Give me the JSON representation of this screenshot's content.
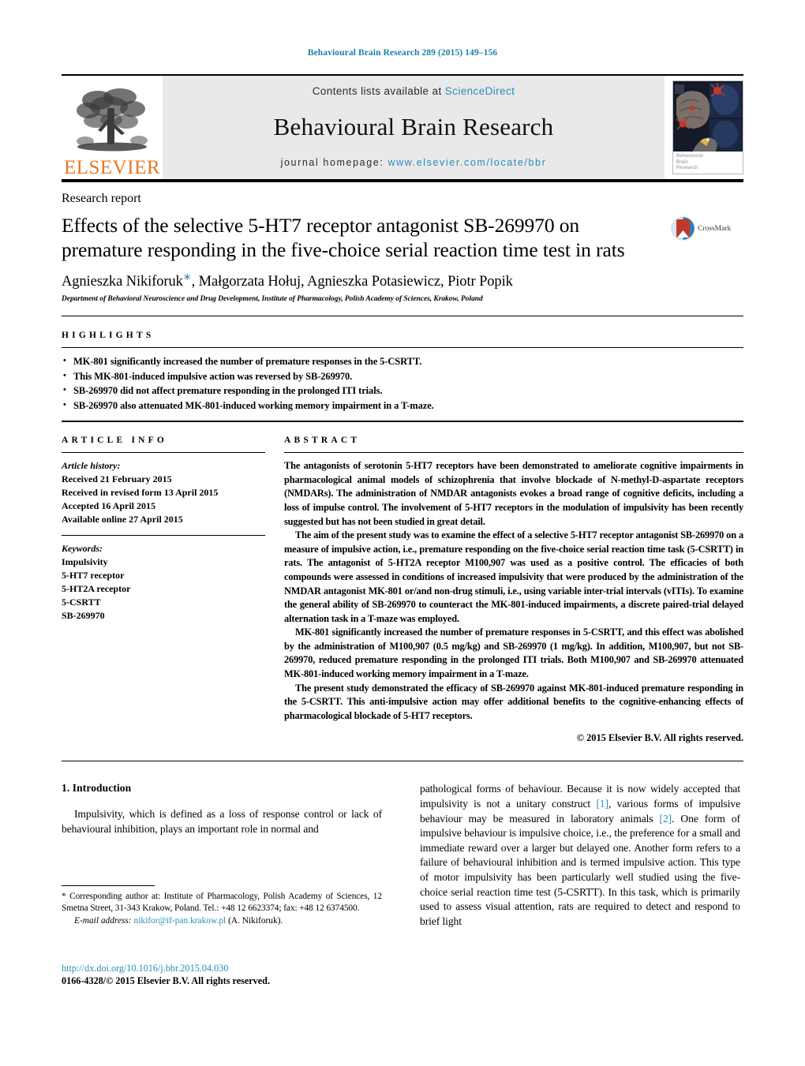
{
  "running_head": "Behavioural Brain Research 289 (2015) 149–156",
  "masthead": {
    "elsevier_wordmark": "ELSEVIER",
    "contents_prefix": "Contents lists available at ",
    "contents_link": "ScienceDirect",
    "journal_title": "Behavioural Brain Research",
    "homepage_prefix": "journal homepage: ",
    "homepage_link": "www.elsevier.com/locate/bbr",
    "cover_caption_line1": "Behavioural",
    "cover_caption_line2": "Brain",
    "cover_caption_line3": "Research"
  },
  "article": {
    "kicker": "Research report",
    "title": "Effects of the selective 5-HT7 receptor antagonist SB-269970 on premature responding in the five-choice serial reaction time test in rats",
    "crossmark_label": "CrossMark",
    "authors": "Agnieszka Nikiforuk",
    "authors_rest": ", Małgorzata Hołuj, Agnieszka Potasiewicz, Piotr Popik",
    "corresponding_mark": "∗",
    "affiliation": "Department of Behavioral Neuroscience and Drug Development, Institute of Pharmacology, Polish Academy of Sciences, Krakow, Poland"
  },
  "highlights": {
    "heading": "HIGHLIGHTS",
    "items": [
      "MK-801 significantly increased the number of premature responses in the 5-CSRTT.",
      "This MK-801-induced impulsive action was reversed by SB-269970.",
      "SB-269970 did not affect premature responding in the prolonged ITI trials.",
      "SB-269970 also attenuated MK-801-induced working memory impairment in a T-maze."
    ]
  },
  "article_info": {
    "heading": "ARTICLE INFO",
    "history_label": "Article history:",
    "history": [
      "Received 21 February 2015",
      "Received in revised form 13 April 2015",
      "Accepted 16 April 2015",
      "Available online 27 April 2015"
    ],
    "keywords_label": "Keywords:",
    "keywords": [
      "Impulsivity",
      "5-HT7 receptor",
      "5-HT2A receptor",
      "5-CSRTT",
      "SB-269970"
    ]
  },
  "abstract": {
    "heading": "ABSTRACT",
    "paragraphs": [
      "The antagonists of serotonin 5-HT7 receptors have been demonstrated to ameliorate cognitive impairments in pharmacological animal models of schizophrenia that involve blockade of N-methyl-D-aspartate receptors (NMDARs). The administration of NMDAR antagonists evokes a broad range of cognitive deficits, including a loss of impulse control. The involvement of 5-HT7 receptors in the modulation of impulsivity has been recently suggested but has not been studied in great detail.",
      "The aim of the present study was to examine the effect of a selective 5-HT7 receptor antagonist SB-269970 on a measure of impulsive action, i.e., premature responding on the five-choice serial reaction time task (5-CSRTT) in rats. The antagonist of 5-HT2A receptor M100,907 was used as a positive control. The efficacies of both compounds were assessed in conditions of increased impulsivity that were produced by the administration of the NMDAR antagonist MK-801 or/and non-drug stimuli, i.e., using variable inter-trial intervals (vITIs). To examine the general ability of SB-269970 to counteract the MK-801-induced impairments, a discrete paired-trial delayed alternation task in a T-maze was employed.",
      "MK-801 significantly increased the number of premature responses in 5-CSRTT, and this effect was abolished by the administration of M100,907 (0.5 mg/kg) and SB-269970 (1 mg/kg). In addition, M100,907, but not SB-269970, reduced premature responding in the prolonged ITI trials. Both M100,907 and SB-269970 attenuated MK-801-induced working memory impairment in a T-maze.",
      "The present study demonstrated the efficacy of SB-269970 against MK-801-induced premature responding in the 5-CSRTT. This anti-impulsive action may offer additional benefits to the cognitive-enhancing effects of pharmacological blockade of 5-HT7 receptors."
    ],
    "copyright": "© 2015 Elsevier B.V. All rights reserved."
  },
  "body": {
    "section_number_title": "1.  Introduction",
    "left_paragraph": "Impulsivity, which is defined as a loss of response control or lack of behavioural inhibition, plays an important role in normal and",
    "right_paragraph_part1": "pathological forms of behaviour. Because it is now widely accepted that impulsivity is not a unitary construct ",
    "ref1": "[1]",
    "right_paragraph_part2": ", various forms of impulsive behaviour may be measured in laboratory animals ",
    "ref2": "[2]",
    "right_paragraph_part3": ". One form of impulsive behaviour is impulsive choice, i.e., the preference for a small and immediate reward over a larger but delayed one. Another form refers to a failure of behavioural inhibition and is termed impulsive action. This type of motor impulsivity has been particularly well studied using the five-choice serial reaction time test (5-CSRTT). In this task, which is primarily used to assess visual attention, rats are required to detect and respond to brief light"
  },
  "footnote": {
    "corresponding": "*  Corresponding author at: Institute of Pharmacology, Polish Academy of Sciences, 12 Smetna Street, 31-343 Krakow, Poland. Tel.: +48 12 6623374; fax: +48 12 6374500.",
    "email_label": "E-mail address:",
    "email": "nikifor@if-pan.krakow.pl",
    "email_suffix": "(A. Nikiforuk).",
    "doi": "http://dx.doi.org/10.1016/j.bbr.2015.04.030",
    "issn": "0166-4328/© 2015 Elsevier B.V. All rights reserved."
  },
  "colors": {
    "link_blue": "#2a8cbb",
    "running_head_blue": "#1a7fa8",
    "elsevier_orange": "#E87722"
  }
}
